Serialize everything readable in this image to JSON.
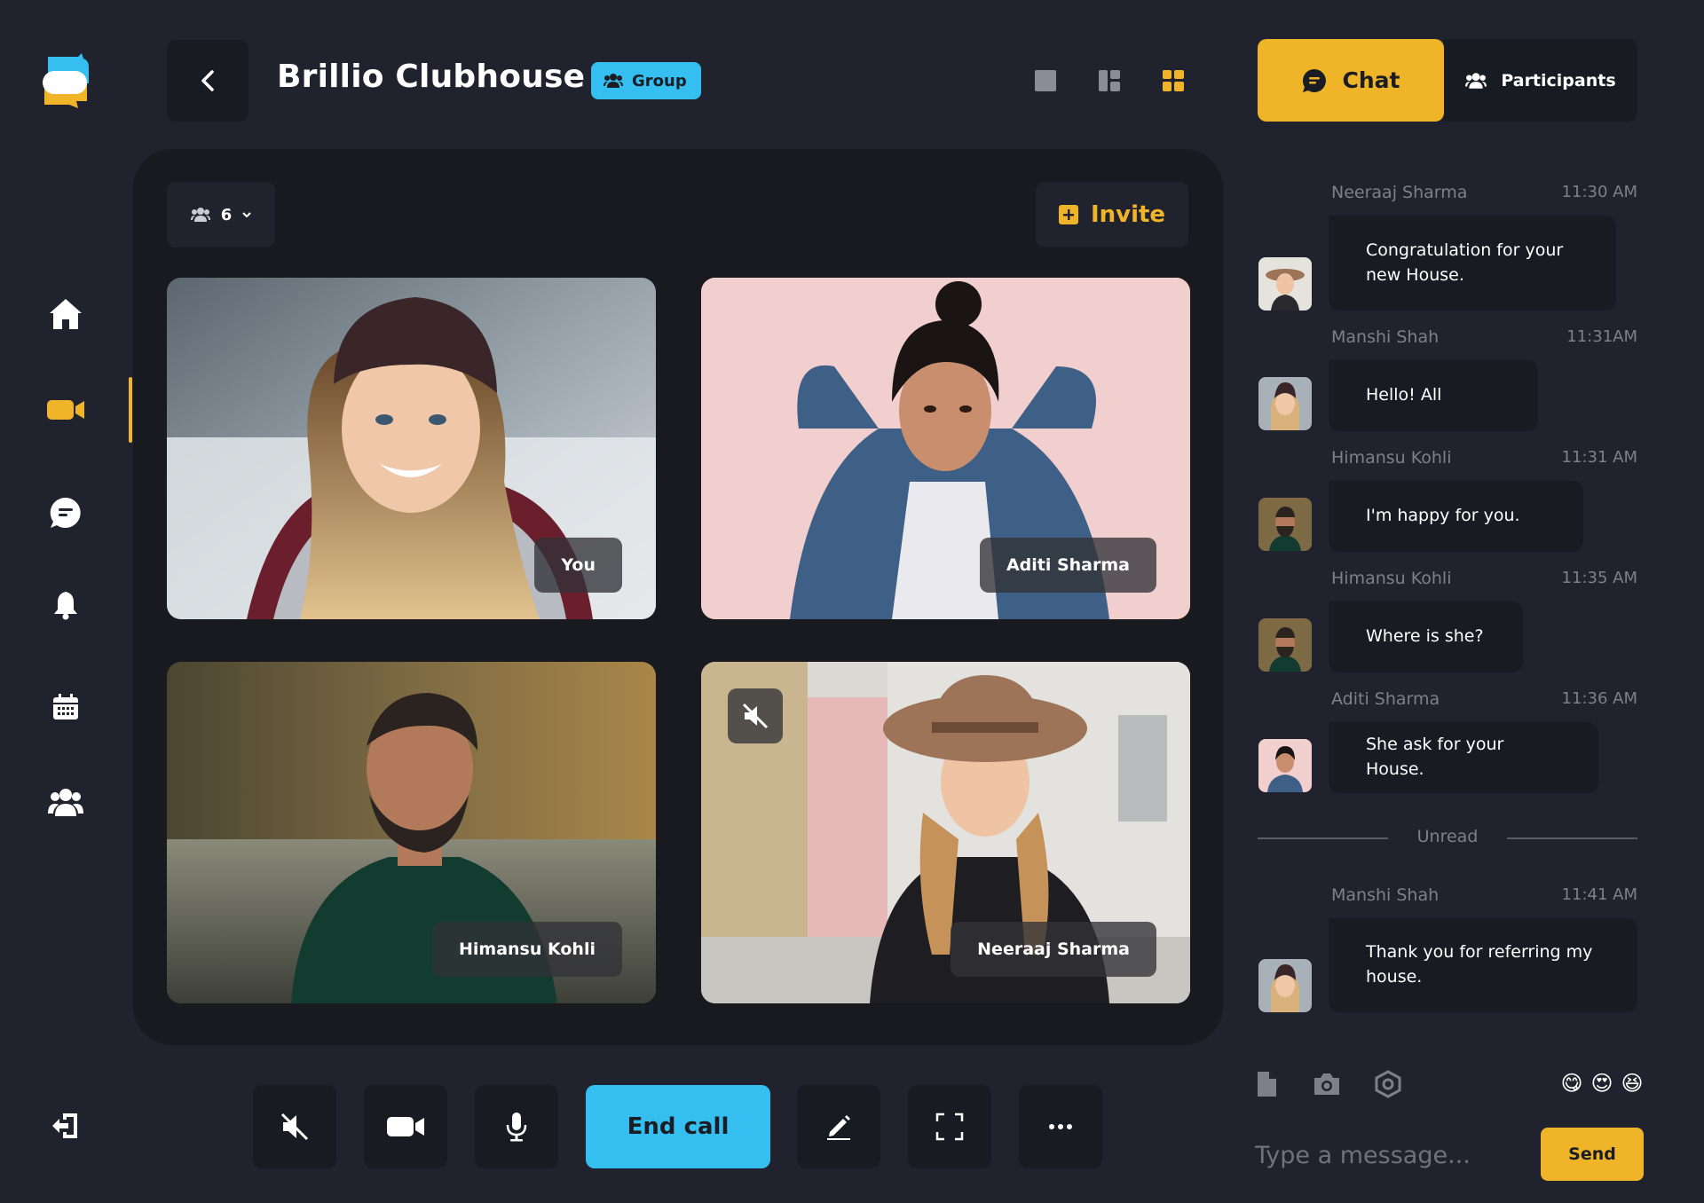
{
  "header": {
    "title": "Brillio Clubhouse",
    "badge": "Group"
  },
  "stage": {
    "participant_count": "6",
    "invite_label": "Invite",
    "tiles": [
      {
        "name": "You"
      },
      {
        "name": "Aditi Sharma"
      },
      {
        "name": "Himansu Kohli"
      },
      {
        "name": "Neeraaj Sharma"
      }
    ]
  },
  "controls": {
    "end_call": "End call"
  },
  "panel": {
    "tabs": {
      "chat": "Chat",
      "participants": "Participants"
    },
    "messages": [
      {
        "name": "Neeraaj Sharma",
        "time": "11:30 AM",
        "text": "Congratulation for your new House."
      },
      {
        "name": "Manshi Shah",
        "time": "11:31AM",
        "text": "Hello! All"
      },
      {
        "name": "Himansu Kohli",
        "time": "11:31 AM",
        "text": "I'm happy for you."
      },
      {
        "name": "Himansu Kohli",
        "time": "11:35 AM",
        "text": "Where is she?"
      },
      {
        "name": "Aditi Sharma",
        "time": "11:36 AM",
        "text": "She ask for your  House."
      },
      {
        "name": "Manshi Shah",
        "time": "11:41 AM",
        "text": "Thank you for referring my house."
      }
    ],
    "unread_label": "Unread",
    "emojis": [
      "😋",
      "😍",
      "😆"
    ],
    "input_placeholder": "Type a message...",
    "send_label": "Send"
  },
  "colors": {
    "accent": "#f0b429",
    "call": "#35bff0",
    "background": "#20232d",
    "surface": "#181b22"
  }
}
